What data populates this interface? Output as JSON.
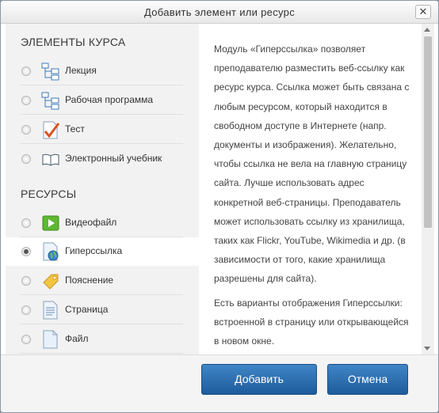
{
  "dialog": {
    "title": "Добавить элемент или ресурс",
    "close_glyph": "✕"
  },
  "sections": {
    "activities_header": "ЭЛЕМЕНТЫ КУРСА",
    "resources_header": "РЕСУРСЫ"
  },
  "activities": [
    {
      "label": "Лекция",
      "icon": "lesson-icon",
      "selected": false
    },
    {
      "label": "Рабочая программа",
      "icon": "workshop-icon",
      "selected": false
    },
    {
      "label": "Тест",
      "icon": "quiz-icon",
      "selected": false
    },
    {
      "label": "Электронный учебник",
      "icon": "book-icon",
      "selected": false
    }
  ],
  "resources": [
    {
      "label": "Видеофайл",
      "icon": "video-icon",
      "selected": false
    },
    {
      "label": "Гиперссылка",
      "icon": "url-icon",
      "selected": true
    },
    {
      "label": "Пояснение",
      "icon": "label-icon",
      "selected": false
    },
    {
      "label": "Страница",
      "icon": "page-icon",
      "selected": false
    },
    {
      "label": "Файл",
      "icon": "file-icon",
      "selected": false
    }
  ],
  "description": {
    "p1": "Модуль «Гиперссылка» позволяет преподавателю разместить веб-ссылку как ресурс курса. Ссылка может быть связана с любым ресурсом, который находится в свободном доступе в Интернете (напр. документы и изображения). Желательно, чтобы ссылка не вела на главную страницу сайта. Лучше использовать адрес конкретной веб-страницы. Преподаватель может использовать ссылку из хранилища, таких как Flickr, YouTube, Wikimedia и др. (в зависимости от того, какие хранилища разрешены для сайта).",
    "p2": "Есть варианты отображения Гиперссылки: встроенной в страницу или открывающейся в новом окне."
  },
  "footer": {
    "add_label": "Добавить",
    "cancel_label": "Отмена"
  },
  "colors": {
    "button": "#2a6db0",
    "selected_row": "#ffffff",
    "list_bg": "#f2f2f2"
  }
}
